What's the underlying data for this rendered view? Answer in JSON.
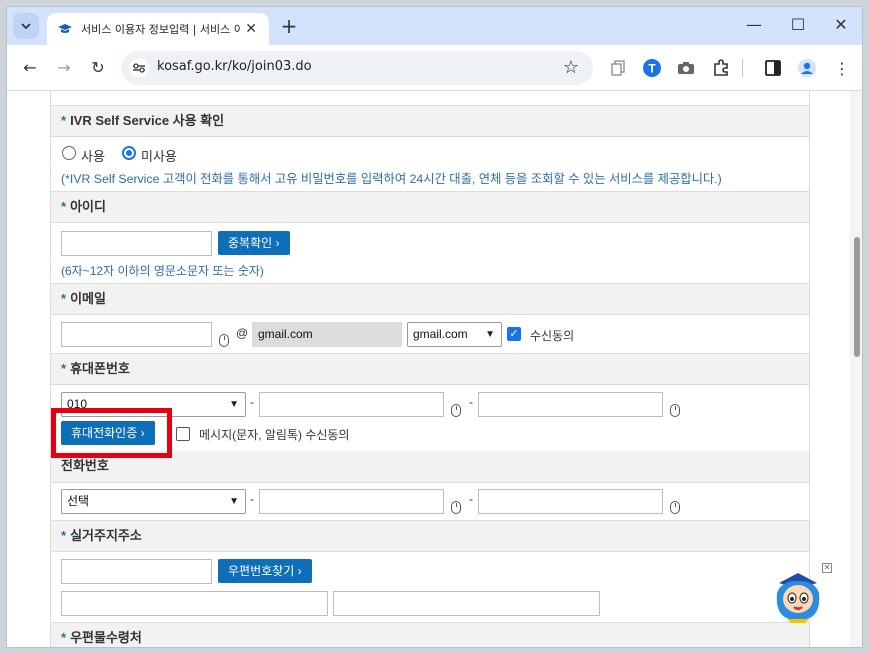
{
  "browser": {
    "tab_title": "서비스 이용자 정보입력 | 서비스 이용",
    "url": "kosaf.go.kr/ko/join03.do"
  },
  "form": {
    "ivr": {
      "label": "IVR Self Service 사용 확인",
      "option_use": "사용",
      "option_nouse": "미사용",
      "selected": "미사용",
      "hint": "(*IVR Self Service 고객이 전화를 통해서 고유 비밀번호를 입력하여 24시간 대출, 연체 등을 조회할 수 있는 서비스를 제공합니다.)"
    },
    "userid": {
      "label": "아이디",
      "value": "",
      "check_button": "중복확인",
      "hint": "(6자~12자 이하의 영문소문자 또는 숫자)"
    },
    "email": {
      "label": "이메일",
      "local_value": "",
      "at": "@",
      "domain_value": "gmail.com",
      "domain_select": "gmail.com",
      "consent_label": "수신동의",
      "consent_checked": true
    },
    "mobile": {
      "label": "휴대폰번호",
      "prefix": "010",
      "dash": "-",
      "verify_button": "휴대전화인증",
      "sms_consent_label": "메시지(문자, 알림톡) 수신동의",
      "sms_consent_checked": false
    },
    "phone": {
      "label": "전화번호",
      "prefix": "선택",
      "dash": "-"
    },
    "address": {
      "label": "실거주지주소",
      "zip_button": "우편번호찾기"
    },
    "mail_address": {
      "label": "우편물수령처"
    },
    "required_mark": "*"
  },
  "colors": {
    "accent": "#0e6eb8",
    "hint": "#2d6ea8",
    "highlight": "#e50012"
  }
}
